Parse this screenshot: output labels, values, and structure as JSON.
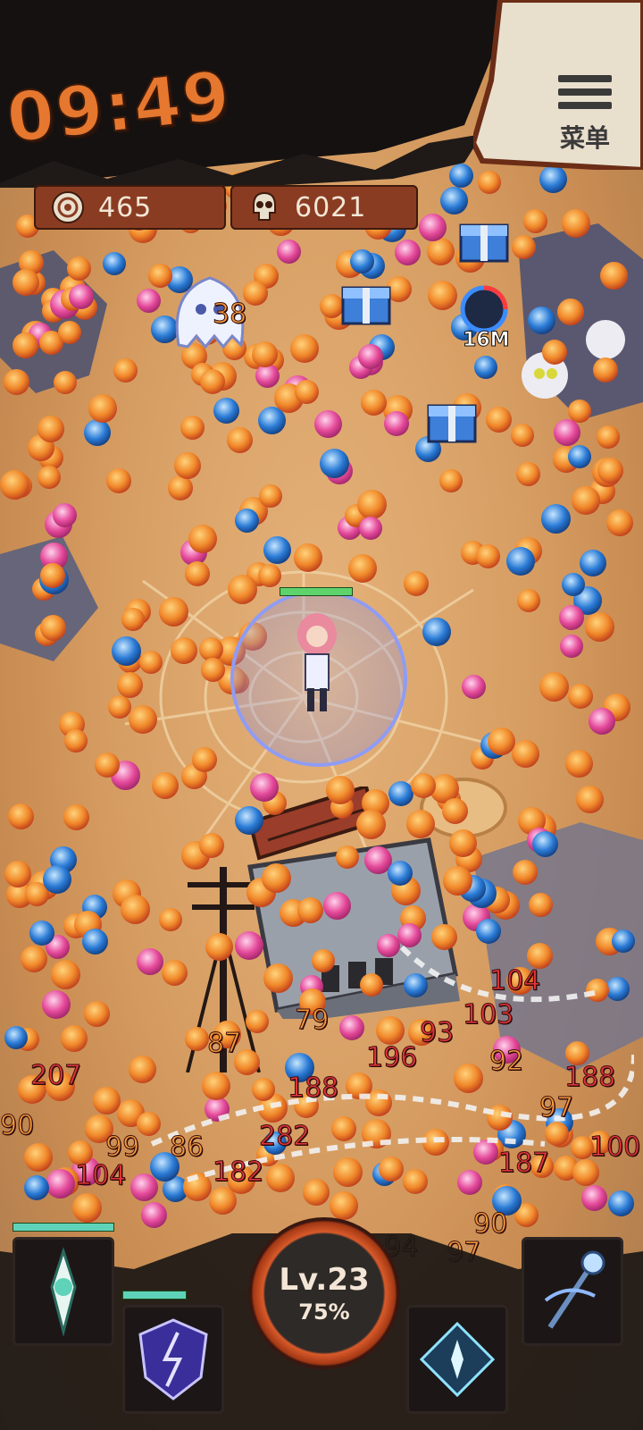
{
  "hud": {
    "timer": "09:49",
    "kills": "465",
    "skulls": "6021",
    "menu_label": "菜单",
    "level": "Lv.23",
    "level_progress": "75%",
    "level_progress_value": 0.75
  },
  "world": {
    "chest_value_label": "16M",
    "damage_numbers": [
      {
        "text": "38",
        "style": "orange"
      },
      {
        "text": "104",
        "style": "red"
      },
      {
        "text": "103",
        "style": "red"
      },
      {
        "text": "93",
        "style": "red"
      },
      {
        "text": "196",
        "style": "red"
      },
      {
        "text": "92",
        "style": "orange"
      },
      {
        "text": "188",
        "style": "red"
      },
      {
        "text": "188",
        "style": "red"
      },
      {
        "text": "97",
        "style": "orange"
      },
      {
        "text": "207",
        "style": "red"
      },
      {
        "text": "87",
        "style": "orange"
      },
      {
        "text": "79",
        "style": "orange"
      },
      {
        "text": "282",
        "style": "red"
      },
      {
        "text": "86",
        "style": "orange"
      },
      {
        "text": "99",
        "style": "orange"
      },
      {
        "text": "182",
        "style": "red"
      },
      {
        "text": "187",
        "style": "red"
      },
      {
        "text": "90",
        "style": "orange"
      },
      {
        "text": "94",
        "style": "orange"
      },
      {
        "text": "97",
        "style": "orange"
      },
      {
        "text": "104",
        "style": "red"
      },
      {
        "text": "90",
        "style": "orange"
      },
      {
        "text": "100",
        "style": "red"
      }
    ]
  },
  "skills": [
    {
      "name": "spirit-blade-skill-icon"
    },
    {
      "name": "lightning-shield-skill-icon"
    },
    {
      "name": "ice-burst-skill-icon"
    },
    {
      "name": "arcane-staff-skill-icon"
    }
  ],
  "colors": {
    "accent": "#e5772f",
    "bar": "#8a3c22",
    "damage": "#e3353a",
    "ground": "#d79e63"
  }
}
